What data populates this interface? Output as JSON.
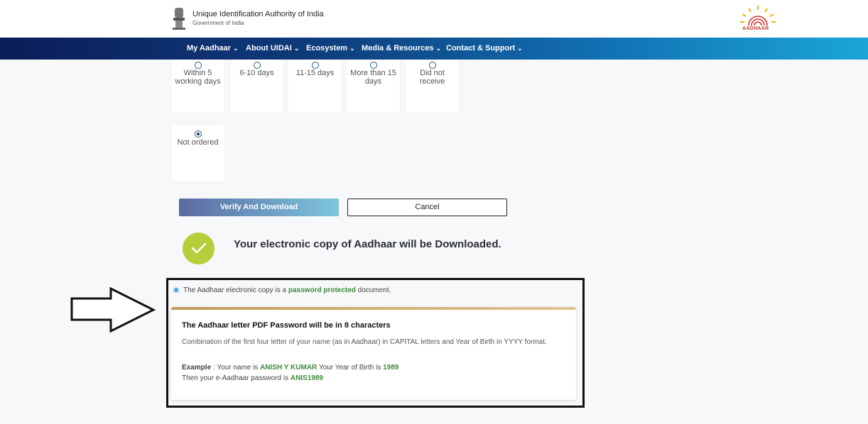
{
  "header": {
    "org_title": "Unique Identification Authority of India",
    "org_subtitle": "Government of India",
    "logo_text": "AADHAAR"
  },
  "nav": {
    "items": [
      {
        "label": "My Aadhaar"
      },
      {
        "label": "About UIDAI"
      },
      {
        "label": "Ecosystem"
      },
      {
        "label": "Media & Resources"
      },
      {
        "label": "Contact & Support"
      }
    ],
    "chevron": "⌄"
  },
  "options": [
    {
      "label_line1": "Within 5",
      "label_line2": "working days",
      "selected": false
    },
    {
      "label_line1": "6-10 days",
      "label_line2": "",
      "selected": false
    },
    {
      "label_line1": "11-15 days",
      "label_line2": "",
      "selected": false
    },
    {
      "label_line1": "More than 15",
      "label_line2": "days",
      "selected": false
    },
    {
      "label_line1": "Did not",
      "label_line2": "receive",
      "selected": false
    },
    {
      "label_line1": "Not ordered",
      "label_line2": "",
      "selected": true
    }
  ],
  "buttons": {
    "verify_label": "Verify And Download",
    "cancel_label": "Cancel"
  },
  "success": {
    "message": "Your electronic copy of Aadhaar will be Downloaded."
  },
  "info": {
    "prefix": "The Aadhaar electronic copy is a ",
    "highlight": "password protected",
    "suffix": " document."
  },
  "password_card": {
    "heading": "The Aadhaar letter PDF Password will be in 8 characters",
    "body": "Combination of the first four letter of your name (as in Aadhaar) in CAPITAL letters and Year of Birth in YYYY format.",
    "example_label": "Example",
    "example_sep": " : Your name is ",
    "example_name": "ANISH Y KUMAR",
    "example_mid": " Your Year of Birth is ",
    "example_year": "1989",
    "then_text": "Then your e-Aadhaar password is ",
    "password": "ANIS1989"
  },
  "colors": {
    "nav_start": "#0b1d59",
    "nav_end": "#1ba6d6",
    "success_green": "#b5cf3a",
    "highlight_green": "#3e8a3e",
    "card_accent": "#c29b58"
  },
  "icons": {
    "emblem": "national-emblem-icon",
    "logo": "aadhaar-logo",
    "check": "check-icon",
    "info": "info-dot-icon",
    "arrow": "right-arrow-icon"
  }
}
